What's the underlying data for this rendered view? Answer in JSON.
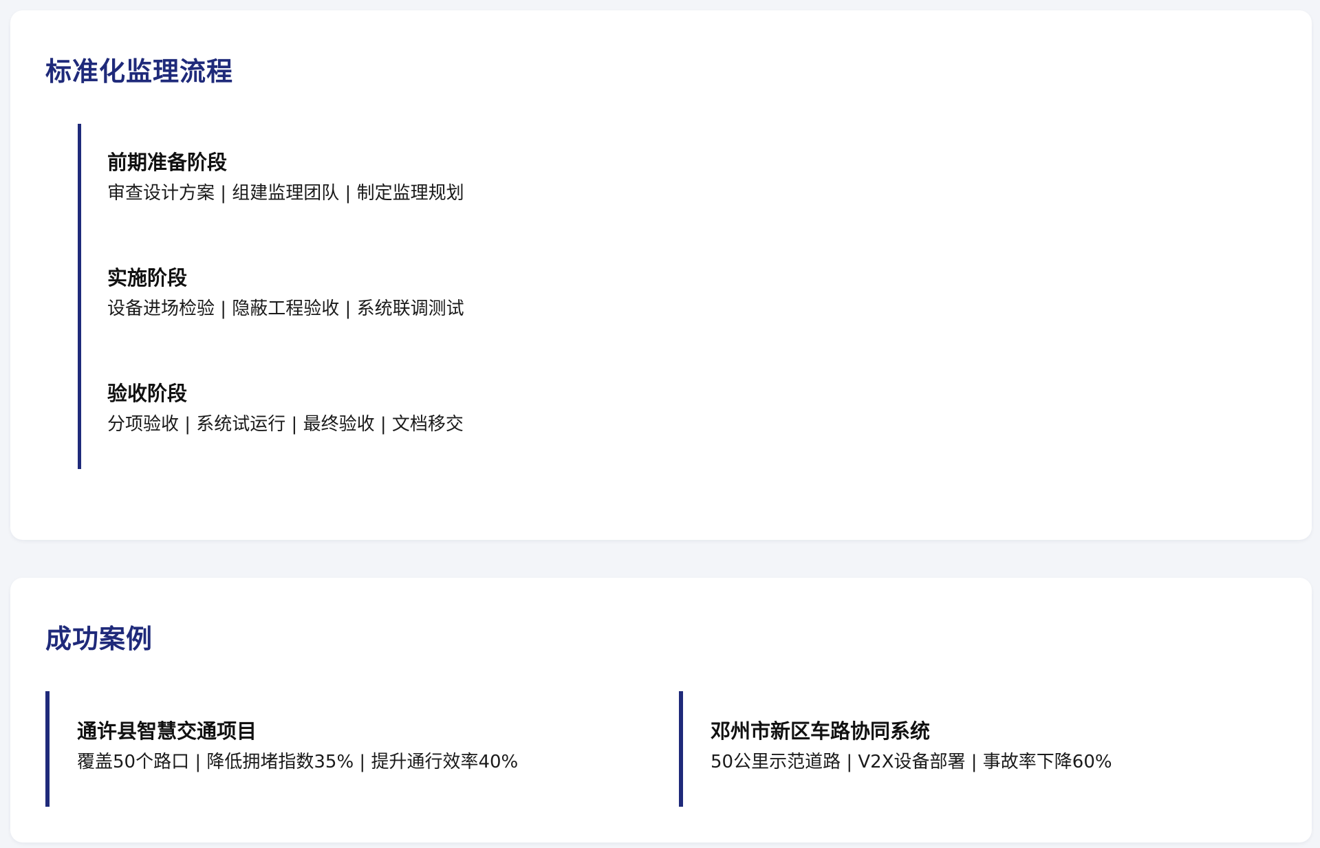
{
  "colors": {
    "background": "#f3f5f9",
    "card": "#ffffff",
    "accent": "#1f2a7a",
    "text": "#111111"
  },
  "process": {
    "title": "标准化监理流程",
    "stages": [
      {
        "title": "前期准备阶段",
        "desc": "审查设计方案 | 组建监理团队 | 制定监理规划"
      },
      {
        "title": "实施阶段",
        "desc": "设备进场检验 | 隐蔽工程验收 | 系统联调测试"
      },
      {
        "title": "验收阶段",
        "desc": "分项验收 | 系统试运行 | 最终验收 | 文档移交"
      }
    ]
  },
  "cases": {
    "title": "成功案例",
    "items": [
      {
        "title": "通许县智慧交通项目",
        "desc": "覆盖50个路口 | 降低拥堵指数35% | 提升通行效率40%"
      },
      {
        "title": "邓州市新区车路协同系统",
        "desc": "50公里示范道路 | V2X设备部署 | 事故率下降60%"
      }
    ]
  }
}
